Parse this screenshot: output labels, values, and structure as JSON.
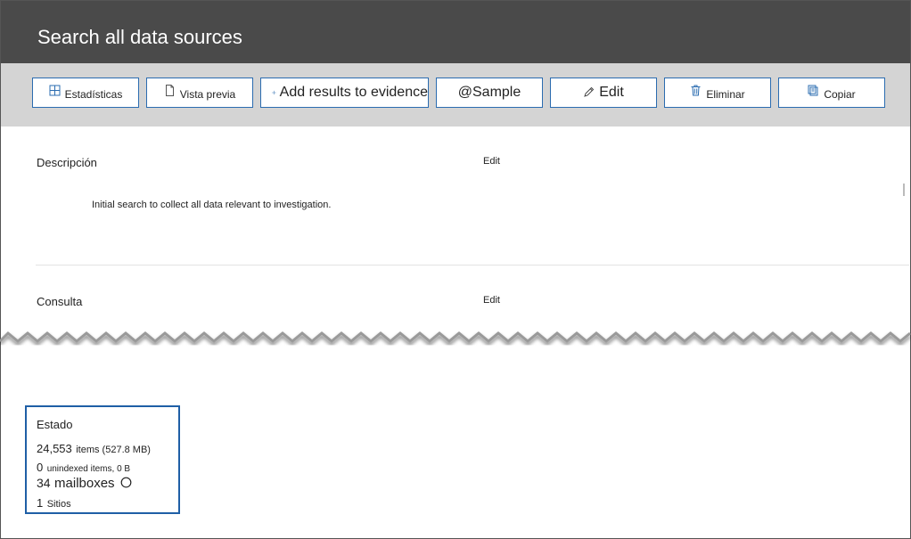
{
  "header": {
    "title": "Search all data sources"
  },
  "toolbar": {
    "buttons": [
      {
        "label": "Estadísticas",
        "icon": "grid-icon"
      },
      {
        "label": "Vista previa",
        "icon": "document-icon"
      },
      {
        "label": "Add results to evidence",
        "icon": "plus-icon"
      },
      {
        "label": "@Sample",
        "icon": ""
      },
      {
        "label": "Edit",
        "icon": "pencil-icon"
      },
      {
        "label": "Eliminar",
        "icon": "trash-icon"
      },
      {
        "label": "Copiar",
        "icon": "copy-icon"
      }
    ]
  },
  "description": {
    "label": "Descripción",
    "edit_label": "Edit",
    "text": "Initial search to collect all data relevant to investigation."
  },
  "query": {
    "label": "Consulta",
    "edit_label": "Edit"
  },
  "status": {
    "label": "Estado",
    "items_count": "24,553",
    "items_text": "items (527.8 MB)",
    "unindexed_count": "0",
    "unindexed_text": "unindexed items, 0 B",
    "mailboxes_count": "34",
    "mailboxes_text": "mailboxes",
    "sites_count": "1",
    "sites_text": "Sitios"
  },
  "colors": {
    "title_bar": "#4a4a4a",
    "toolbar_bg": "#d4d4d4",
    "button_border": "#2b6cb0",
    "status_border": "#1f5fa6"
  }
}
